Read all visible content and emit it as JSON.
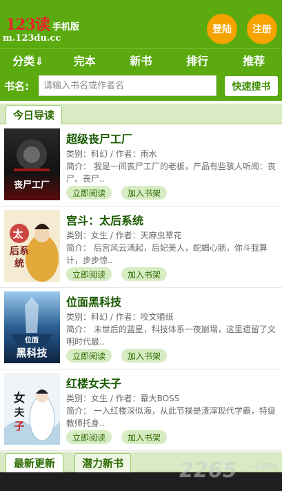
{
  "header": {
    "logo_main": "123读",
    "logo_sub": "手机版",
    "logo_domain": "m.123du.cc",
    "login_label": "登陆",
    "register_label": "注册"
  },
  "nav": {
    "items": [
      {
        "label": "分类⇓"
      },
      {
        "label": "完本"
      },
      {
        "label": "新书"
      },
      {
        "label": "排行"
      },
      {
        "label": "推荐"
      }
    ]
  },
  "search": {
    "label": "书名:",
    "placeholder": "请输入书名或作者名",
    "button_label": "快速搜书"
  },
  "section_today": {
    "tab_label": "今日导读"
  },
  "books": [
    {
      "title": "超级丧尸工厂",
      "meta": "类别：科幻 / 作者：雨水",
      "intro": "简介：   我是一间丧尸工厂的老板，产品有些骇人听闻：丧尸、丧尸..",
      "read_label": "立即阅读",
      "shelf_label": "加入书架",
      "cover_text": "丧尸工厂",
      "cover_colors": [
        "#1a1a1a",
        "#7a0f0f"
      ]
    },
    {
      "title": "宫斗：太后系统",
      "meta": "类别：女生 / 作者：天麻虫草花",
      "intro": "简介：   后宫风云涌起，后妃美人，蛇蝎心肠，你斗我算计，步步惊..",
      "read_label": "立即阅读",
      "shelf_label": "加入书架",
      "cover_text": "太后系统",
      "cover_colors": [
        "#f4e9cf",
        "#e3b23c"
      ]
    },
    {
      "title": "位面黑科技",
      "meta": "类别：科幻 / 作者：咬文嚼纸",
      "intro": "简介：   末世后的蓝星，科技体系一夜崩塌，这里遗留了文明时代最..",
      "read_label": "立即阅读",
      "shelf_label": "加入书架",
      "cover_text": "位面黑科技",
      "cover_colors": [
        "#10345a",
        "#7fb8e6"
      ]
    },
    {
      "title": "红楼女夫子",
      "meta": "类别：女生 / 作者：幕大BOSS",
      "intro": "简介：   一入红楼深似海，从此节操是渣滓现代学霸，特级教师托身..",
      "read_label": "立即阅读",
      "shelf_label": "加入书架",
      "cover_text": "女夫子",
      "cover_colors": [
        "#eef3f7",
        "#8fb7cf"
      ]
    }
  ],
  "section_bottom": {
    "tab1_label": "最新更新",
    "tab2_label": "潜力新书"
  },
  "watermark": {
    "main": "2265",
    "sub": "手游网"
  }
}
